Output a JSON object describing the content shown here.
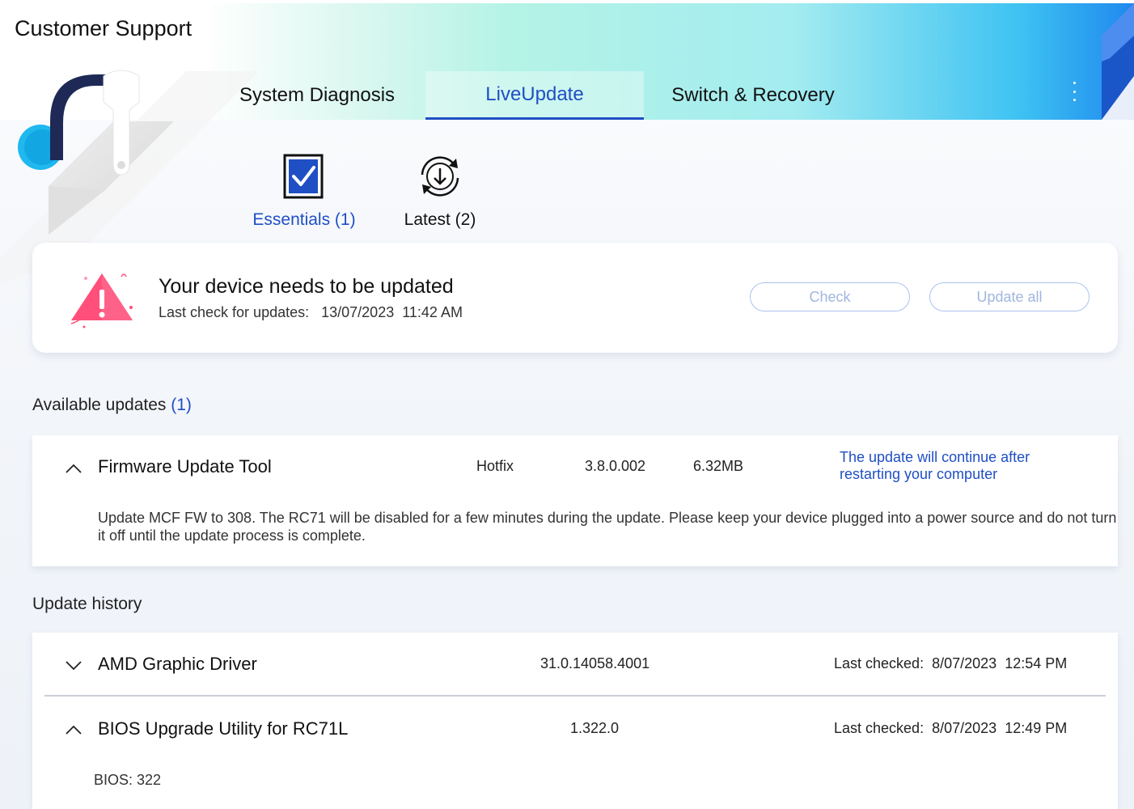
{
  "app": {
    "title": "Customer Support"
  },
  "tabs": [
    {
      "label": "System Diagnosis",
      "active": false
    },
    {
      "label": "LiveUpdate",
      "active": true
    },
    {
      "label": "Switch & Recovery",
      "active": false
    }
  ],
  "more_menu_icon": "kebab-icon",
  "subtabs": [
    {
      "label": "Essentials (1)",
      "icon": "checkbox-icon",
      "active": true
    },
    {
      "label": "Latest (2)",
      "icon": "download-refresh-icon",
      "active": false
    }
  ],
  "status": {
    "title": "Your device needs to be updated",
    "last_check_label": "Last check for updates:",
    "last_check_date": "13/07/2023",
    "last_check_time": "11:42 AM",
    "check_button": "Check",
    "update_all_button": "Update all"
  },
  "available": {
    "title": "Available updates",
    "count": "(1)",
    "items": [
      {
        "name": "Firmware Update Tool",
        "category": "Hotfix",
        "version": "3.8.0.002",
        "size": "6.32MB",
        "note": "The update will continue after restarting your computer",
        "description": "Update MCF FW to 308. The RC71 will be disabled for a few minutes during the update. Please keep your device plugged into a power source and do not turn it off until the update process is complete."
      }
    ]
  },
  "history": {
    "title": "Update history",
    "items": [
      {
        "name": "AMD Graphic Driver",
        "version": "31.0.14058.4001",
        "last_checked_label": "Last checked:",
        "date": "8/07/2023",
        "time": "12:54 PM",
        "expanded": false
      },
      {
        "name": "BIOS Upgrade Utility for RC71L",
        "version": "1.322.0",
        "last_checked_label": "Last checked:",
        "date": "8/07/2023",
        "time": "12:49 PM",
        "expanded": true,
        "detail": "BIOS: 322"
      }
    ]
  }
}
